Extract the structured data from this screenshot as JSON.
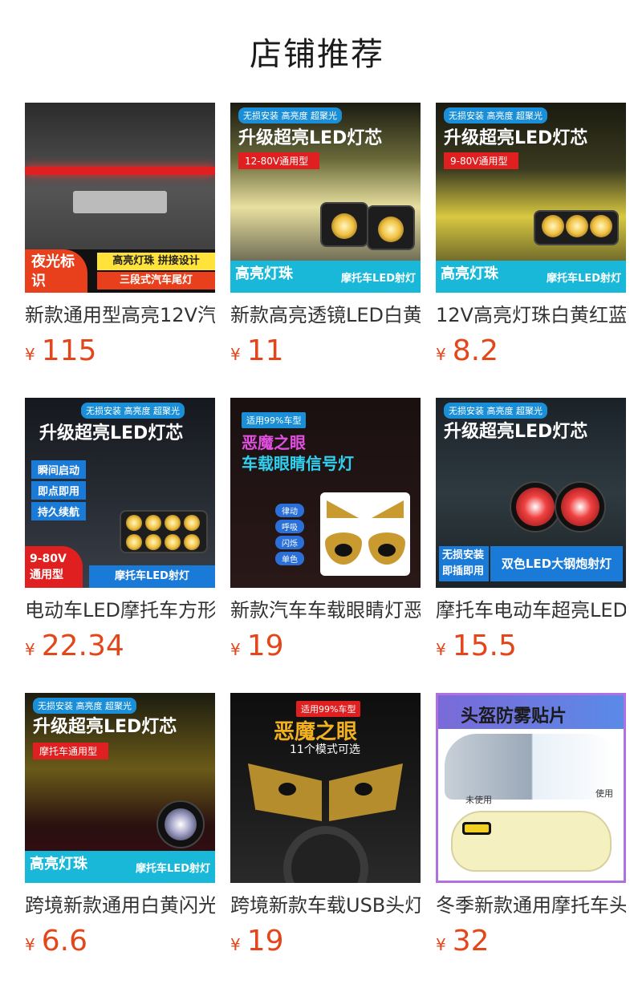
{
  "header": {
    "title": "店铺推荐"
  },
  "currency": "¥",
  "products": [
    {
      "title": "新款通用型高亮12V汽",
      "price": "115",
      "badge": "夜光标识",
      "tag1": "高亮灯珠 拼接设计",
      "tag2": "三段式汽车尾灯"
    },
    {
      "title": "新款高亮透镜LED白黄",
      "price": "11",
      "chip": "无损安装 高亮度 超聚光",
      "headline": "升级超亮LED灯芯",
      "sub": "12-80V通用型",
      "left": "高亮灯珠",
      "right": "摩托车LED射灯"
    },
    {
      "title": "12V高亮灯珠白黄红蓝",
      "price": "8.2",
      "chip": "无损安装 高亮度 超聚光",
      "headline": "升级超亮LED灯芯",
      "sub": "9-80V通用型",
      "left": "高亮灯珠",
      "right": "摩托车LED射灯"
    },
    {
      "title": "电动车LED摩托车方形",
      "price": "22.34",
      "chip": "无损安装 高亮度 超聚光",
      "headline": "升级超亮LED灯芯",
      "f1": "瞬间启动",
      "f2": "即点即用",
      "f3": "持久续航",
      "volt": "9-80V 通用型",
      "right": "摩托车LED射灯"
    },
    {
      "title": "新款汽车车载眼睛灯恶",
      "price": "19",
      "chip": "适用99%车型",
      "headline1": "恶魔之眼",
      "headline2": "车载眼睛信号灯",
      "m1": "律动",
      "m2": "呼吸",
      "m3": "闪烁",
      "m4": "单色"
    },
    {
      "title": "摩托车电动车超亮LED",
      "price": "15.5",
      "chip": "无损安装 高亮度 超聚光",
      "headline": "升级超亮LED灯芯",
      "left": "无损安装 即插即用",
      "right": "双色LED大钢炮射灯"
    },
    {
      "title": "跨境新款通用白黄闪光",
      "price": "6.6",
      "chip": "无损安装 高亮度 超聚光",
      "headline": "升级超亮LED灯芯",
      "sub": "摩托车通用型",
      "left": "高亮灯珠",
      "right": "摩托车LED射灯"
    },
    {
      "title": "跨境新款车载USB头灯",
      "price": "19",
      "chip": "适用99%车型",
      "headline": "恶魔之眼",
      "sub": "11个模式可选"
    },
    {
      "title": "冬季新款通用摩托车头",
      "price": "32",
      "headline": "头盔防雾贴片",
      "l1": "未使用",
      "l2": "使用"
    }
  ]
}
